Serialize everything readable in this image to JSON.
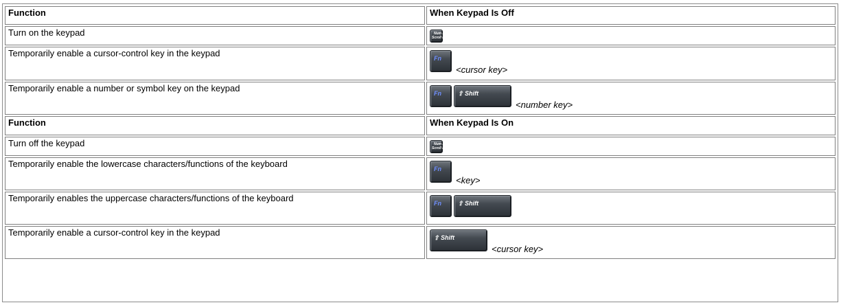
{
  "off_table": {
    "header": {
      "function": "Function",
      "state": "When Keypad Is Off"
    },
    "rows": [
      {
        "function": "Turn on the keypad",
        "keys": [
          "numlk"
        ],
        "after": ""
      },
      {
        "function": "Temporarily enable a cursor-control key in the keypad",
        "keys": [
          "fn"
        ],
        "after": "<cursor key>"
      },
      {
        "function": "Temporarily enable a number or symbol key on the keypad",
        "keys": [
          "fn",
          "shift"
        ],
        "after": "<number key>"
      }
    ]
  },
  "on_table": {
    "header": {
      "function": "Function",
      "state": "When Keypad Is On"
    },
    "rows": [
      {
        "function": "Turn off the keypad",
        "keys": [
          "numlk"
        ],
        "after": ""
      },
      {
        "function": "Temporarily enable the lowercase characters/functions of the keyboard",
        "keys": [
          "fn"
        ],
        "after": "<key>"
      },
      {
        "function": "Temporarily enables the uppercase characters/functions of the keyboard",
        "keys": [
          "fn",
          "shift"
        ],
        "after": ""
      },
      {
        "function": "Temporarily enable a cursor-control key in the keypad",
        "keys": [
          "shift"
        ],
        "after": "<cursor key>"
      }
    ]
  },
  "key_labels": {
    "numlk_line1": "Num Lk",
    "numlk_line2": "Scroll Lk",
    "fn": "Fn",
    "shift": "⇧ Shift"
  },
  "key_icons": {
    "numlk": "num-lock-key-icon",
    "fn": "fn-key-icon",
    "shift": "shift-key-icon"
  }
}
